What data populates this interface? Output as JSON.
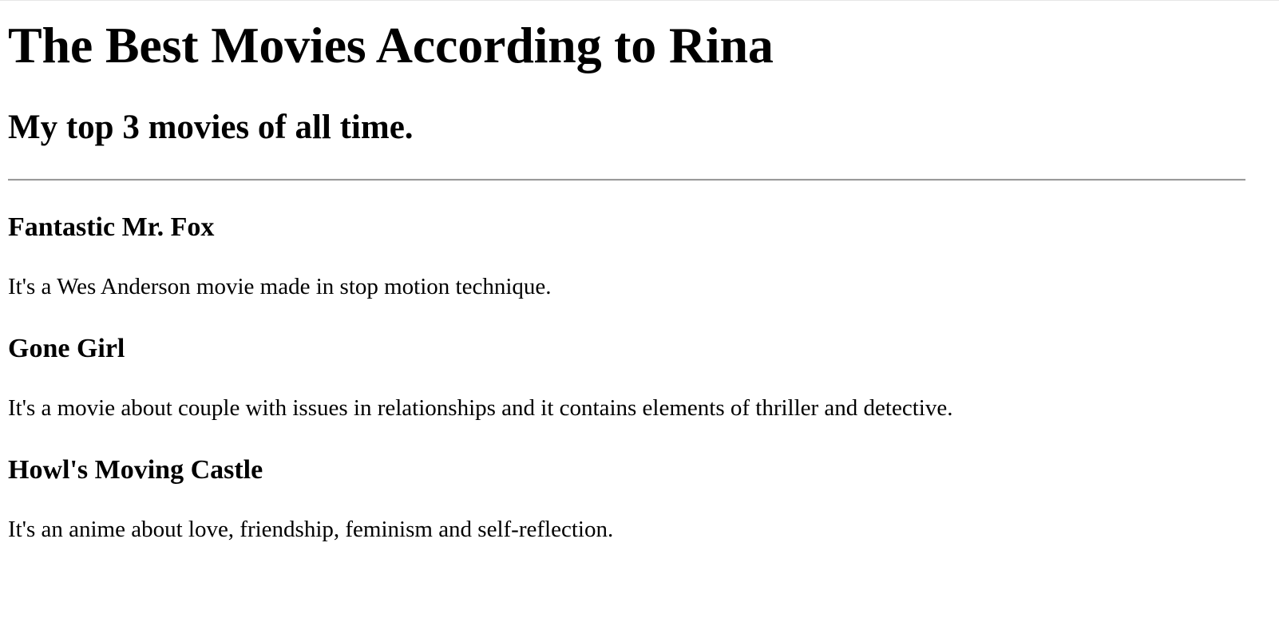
{
  "page": {
    "title": "The Best Movies According to Rina",
    "subtitle": "My top 3 movies of all time."
  },
  "movies": [
    {
      "title": "Fantastic Mr. Fox",
      "description": "It's a Wes Anderson movie made in stop motion technique."
    },
    {
      "title": "Gone Girl",
      "description": "It's a movie about couple with issues in relationships and it contains elements of thriller and detective."
    },
    {
      "title": "Howl's Moving Castle",
      "description": "It's an anime about love, friendship, feminism and self-reflection."
    }
  ]
}
